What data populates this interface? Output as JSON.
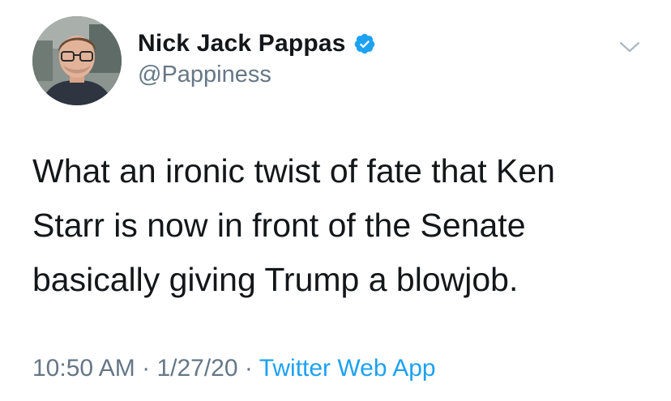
{
  "tweet": {
    "author": {
      "display_name": "Nick Jack Pappas",
      "handle": "@Pappiness",
      "verified": true
    },
    "body_lines": [
      "What an ironic twist of fate that Ken",
      "Starr is now in front of the Senate",
      "basically giving Trump a blowjob."
    ],
    "time": "10:50 AM",
    "date": "1/27/20",
    "separator": "·",
    "source_app": "Twitter Web App"
  },
  "icons": {
    "verified": "verified-badge-icon",
    "menu": "chevron-down-icon"
  },
  "colors": {
    "accent": "#1da1f2",
    "text_primary": "#14171a",
    "text_secondary": "#657786"
  }
}
